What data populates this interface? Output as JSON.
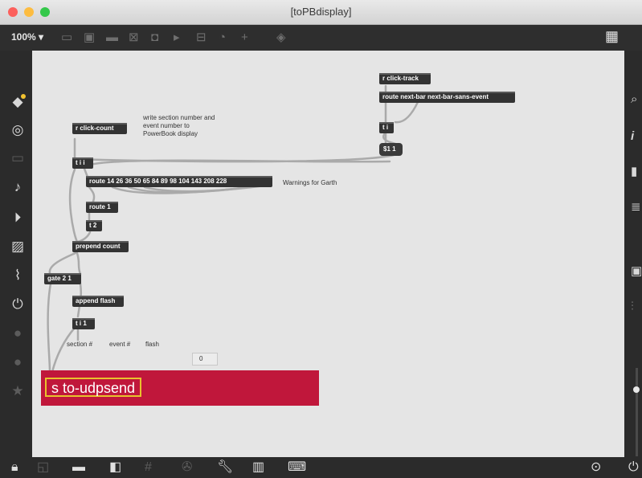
{
  "window": {
    "title": "[toPBdisplay]"
  },
  "toolbar": {
    "zoom": "100% ▾"
  },
  "patch": {
    "objects": {
      "r_click_count": "r click-count",
      "t_i_i": "t i i",
      "route_warnings": "route 14 26 36 50 65 84 89 98 104 143 208 228",
      "route_1": "route 1",
      "t_2": "t 2",
      "prepend_count": "prepend count",
      "gate": "gate 2 1",
      "append_flash": "append flash",
      "t_i_1": "t i 1",
      "r_click_track": "r click-track",
      "route_next_bar": "route next-bar next-bar-sans-event",
      "t_i": "t i",
      "msg_1_1": "$1 1",
      "s_to_udpsend": "s to-udpsend"
    },
    "comments": {
      "write_section": "write section number and event number to PowerBook display",
      "warnings": "Warnings for Garth",
      "section": "section #",
      "event": "event #",
      "flash": "flash"
    },
    "number_box": "0"
  },
  "colors": {
    "send_bg": "#c0173b",
    "send_outline": "#e8c22d",
    "cord": "#aaaaaa"
  }
}
